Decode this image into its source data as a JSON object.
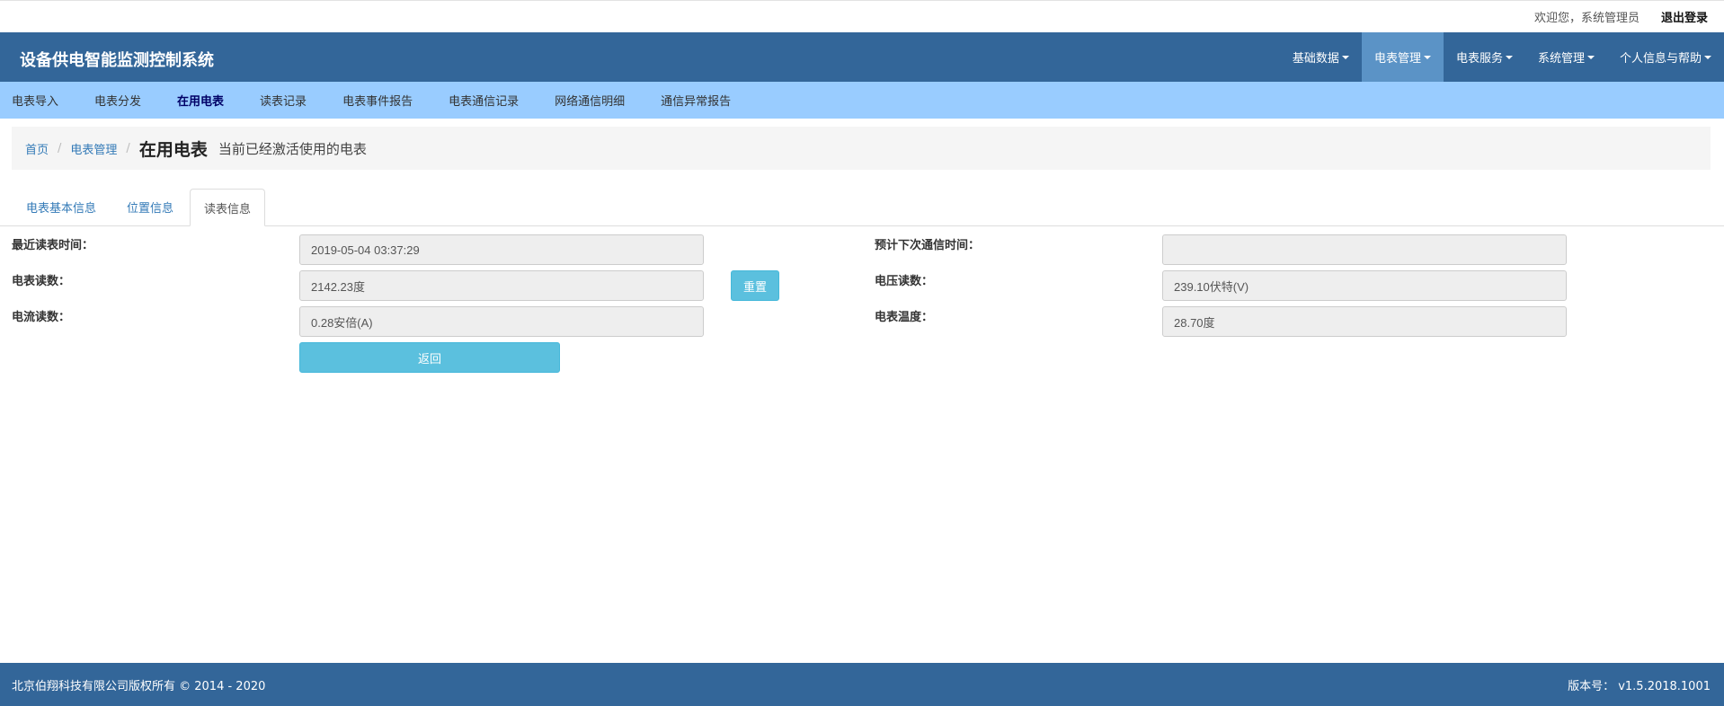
{
  "topbar": {
    "welcome": "欢迎您，系统管理员",
    "logout": "退出登录"
  },
  "navbar": {
    "brand": "设备供电智能监测控制系统",
    "menu": [
      {
        "label": "基础数据"
      },
      {
        "label": "电表管理",
        "active": true
      },
      {
        "label": "电表服务"
      },
      {
        "label": "系统管理"
      },
      {
        "label": "个人信息与帮助"
      }
    ]
  },
  "subnav": {
    "items": [
      {
        "label": "电表导入"
      },
      {
        "label": "电表分发"
      },
      {
        "label": "在用电表",
        "active": true
      },
      {
        "label": "读表记录"
      },
      {
        "label": "电表事件报告"
      },
      {
        "label": "电表通信记录"
      },
      {
        "label": "网络通信明细"
      },
      {
        "label": "通信异常报告"
      }
    ]
  },
  "breadcrumb": {
    "home": "首页",
    "section": "电表管理",
    "current": "在用电表",
    "description": "当前已经激活使用的电表"
  },
  "tabs": [
    {
      "label": "电表基本信息"
    },
    {
      "label": "位置信息"
    },
    {
      "label": "读表信息",
      "active": true
    }
  ],
  "form": {
    "last_read_time_label": "最近读表时间：",
    "last_read_time_value": "2019-05-04 03:37:29",
    "next_comm_time_label": "预计下次通信时间：",
    "next_comm_time_value": "",
    "meter_reading_label": "电表读数：",
    "meter_reading_value": "2142.23度",
    "reset_button": "重置",
    "voltage_label": "电压读数：",
    "voltage_value": "239.10伏特(V)",
    "current_label": "电流读数：",
    "current_value": "0.28安倍(A)",
    "temperature_label": "电表温度：",
    "temperature_value": "28.70度",
    "back_button": "返回"
  },
  "footer": {
    "copyright": "北京伯翔科技有限公司版权所有 © 2014 - 2020",
    "version": "版本号： v1.5.2018.1001"
  },
  "colors": {
    "navbar": "#336699",
    "navbar_active": "#5b93c6",
    "subnav": "#99ccff",
    "info_button": "#5bc0de",
    "footer": "#336699"
  }
}
